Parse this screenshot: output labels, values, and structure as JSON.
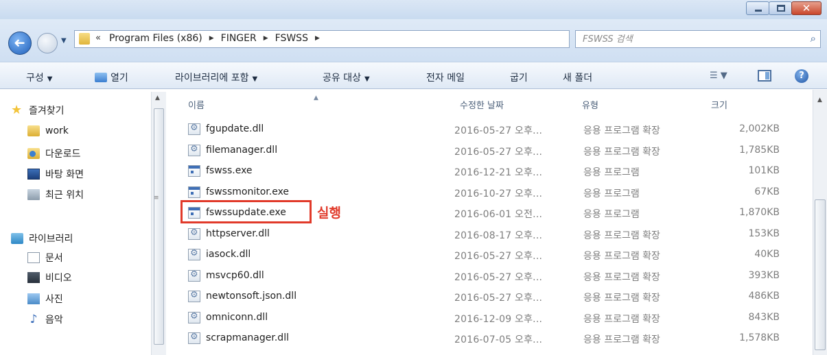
{
  "window": {
    "minimize_label": "",
    "maximize_label": "",
    "close_label": "✕"
  },
  "address": {
    "overflow": "«",
    "crumbs": [
      "Program Files (x86)",
      "FINGER",
      "FSWSS"
    ],
    "search_placeholder": "FSWSS 검색"
  },
  "toolbar": {
    "organize": "구성",
    "open": "열기",
    "include_library": "라이브러리에 포함",
    "share": "공유 대상",
    "email": "전자 메일",
    "burn": "굽기",
    "new_folder": "새 폴더"
  },
  "nav": {
    "favorites": "즐겨찾기",
    "work": "work",
    "downloads": "다운로드",
    "desktop": "바탕 화면",
    "recent": "최근 위치",
    "libraries": "라이브러리",
    "documents": "문서",
    "videos": "비디오",
    "pictures": "사진",
    "music": "음악"
  },
  "columns": {
    "name": "이름",
    "date": "수정한 날짜",
    "type": "유형",
    "size": "크기"
  },
  "files": [
    {
      "name": "fgupdate.dll",
      "date": "2016-05-27 오후...",
      "type": "응용 프로그램 확장",
      "size": "2,002KB",
      "kind": "dll"
    },
    {
      "name": "filemanager.dll",
      "date": "2016-05-27 오후...",
      "type": "응용 프로그램 확장",
      "size": "1,785KB",
      "kind": "dll"
    },
    {
      "name": "fswss.exe",
      "date": "2016-12-21 오후...",
      "type": "응용 프로그램",
      "size": "101KB",
      "kind": "exe"
    },
    {
      "name": "fswssmonitor.exe",
      "date": "2016-10-27 오후...",
      "type": "응용 프로그램",
      "size": "67KB",
      "kind": "exe"
    },
    {
      "name": "fswssupdate.exe",
      "date": "2016-06-01 오전...",
      "type": "응용 프로그램",
      "size": "1,870KB",
      "kind": "exe"
    },
    {
      "name": "httpserver.dll",
      "date": "2016-08-17 오후...",
      "type": "응용 프로그램 확장",
      "size": "153KB",
      "kind": "dll"
    },
    {
      "name": "iasock.dll",
      "date": "2016-05-27 오후...",
      "type": "응용 프로그램 확장",
      "size": "40KB",
      "kind": "dll"
    },
    {
      "name": "msvcp60.dll",
      "date": "2016-05-27 오후...",
      "type": "응용 프로그램 확장",
      "size": "393KB",
      "kind": "dll"
    },
    {
      "name": "newtonsoft.json.dll",
      "date": "2016-05-27 오후...",
      "type": "응용 프로그램 확장",
      "size": "486KB",
      "kind": "dll"
    },
    {
      "name": "omniconn.dll",
      "date": "2016-12-09 오후...",
      "type": "응용 프로그램 확장",
      "size": "843KB",
      "kind": "dll"
    },
    {
      "name": "scrapmanager.dll",
      "date": "2016-07-05 오후...",
      "type": "응용 프로그램 확장",
      "size": "1,578KB",
      "kind": "dll"
    }
  ],
  "annotation": {
    "label": "실행",
    "color": "#e13a2a"
  },
  "colors": {
    "chrome": "#cfdff2",
    "accent": "#1f5fb9"
  }
}
